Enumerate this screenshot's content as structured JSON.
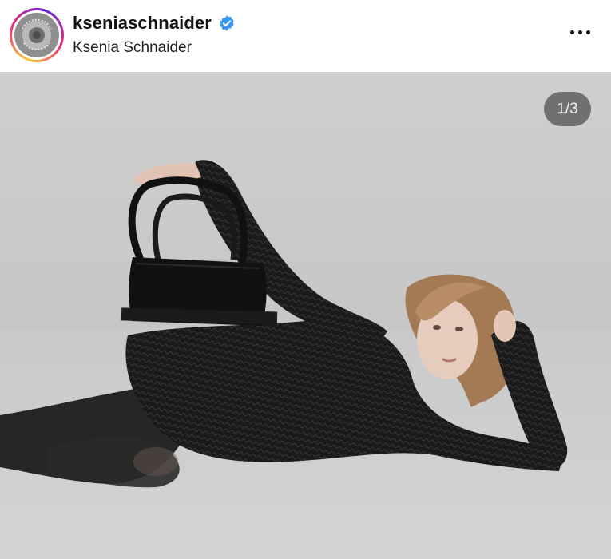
{
  "post_header": {
    "username": "kseniaschnaider",
    "full_name": "Ksenia Schnaider",
    "verified": true,
    "avatar_icon": "kseniaschnaider-logo-icon",
    "more_icon": "more-options-icon"
  },
  "media": {
    "counter": "1/3",
    "current": 1,
    "total": 3,
    "description_icon": "photo"
  },
  "colors": {
    "verified_badge": "#3897f0",
    "photo_background": "#cbcbcb",
    "counter_background": "#505050"
  }
}
